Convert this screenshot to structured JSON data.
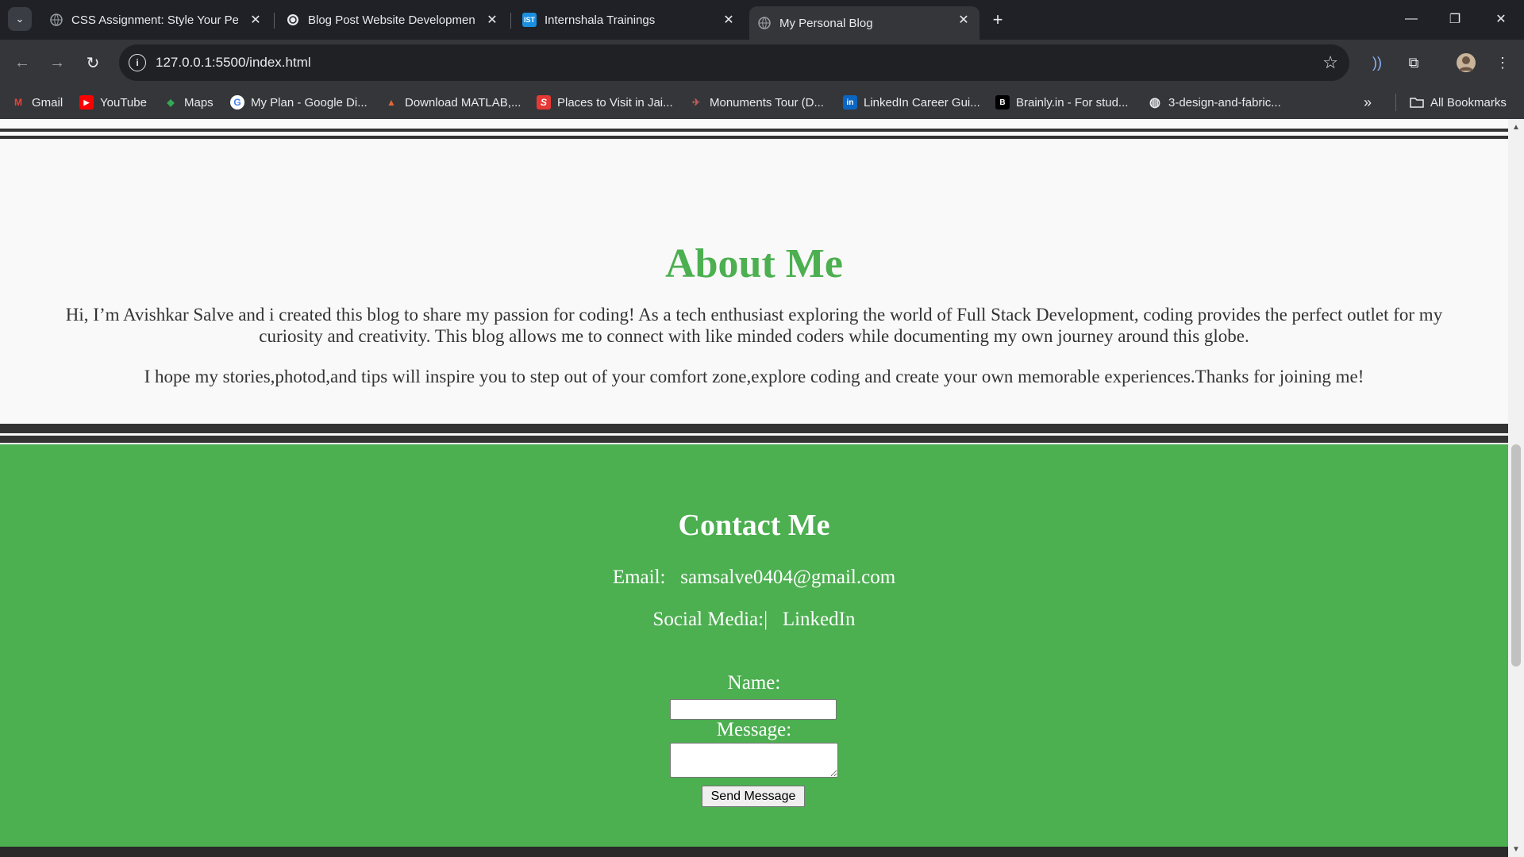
{
  "browser": {
    "tabs": [
      {
        "title": "CSS Assignment: Style Your Pers",
        "icon": "globe-icon"
      },
      {
        "title": "Blog Post Website Developmen",
        "icon": "chatgpt-icon"
      },
      {
        "title": "Internshala Trainings",
        "icon": "ist-icon",
        "icon_text": "IST"
      },
      {
        "title": "My Personal Blog",
        "icon": "globe-icon",
        "active": true
      }
    ],
    "url": "127.0.0.1:5500/index.html",
    "bookmarks": [
      {
        "label": "Gmail",
        "icon": "gmail-icon",
        "icon_text": "M"
      },
      {
        "label": "YouTube",
        "icon": "youtube-icon",
        "icon_text": "▶"
      },
      {
        "label": "Maps",
        "icon": "maps-icon",
        "icon_text": "◆"
      },
      {
        "label": "My Plan - Google Di...",
        "icon": "google-icon",
        "icon_text": "G"
      },
      {
        "label": "Download MATLAB,...",
        "icon": "matlab-icon",
        "icon_text": "▲"
      },
      {
        "label": "Places to Visit in Jai...",
        "icon": "s-icon",
        "icon_text": "S"
      },
      {
        "label": "Monuments Tour (D...",
        "icon": "monument-icon",
        "icon_text": "✈"
      },
      {
        "label": "LinkedIn Career Gui...",
        "icon": "linkedin-icon",
        "icon_text": "in"
      },
      {
        "label": "Brainly.in - For stud...",
        "icon": "brainly-icon",
        "icon_text": "B"
      },
      {
        "label": "3-design-and-fabric...",
        "icon": "globe-icon",
        "icon_text": "◍"
      }
    ],
    "all_bookmarks": "All Bookmarks"
  },
  "colors": {
    "accent_green": "#4caf50",
    "divider": "#333333",
    "page_bg": "#f9f9f9"
  },
  "about": {
    "heading": "About Me",
    "para1": "Hi, I’m Avishkar Salve and i created this blog to share my passion for coding! As a tech enthusiast exploring the world of Full Stack Development, coding provides the perfect outlet for my curiosity and creativity. This blog allows me to connect with like minded coders while documenting my own journey around this globe.",
    "para2": "I hope my stories,photod,and tips will inspire you to step out of your comfort zone,explore coding and create your own memorable experiences.Thanks for joining me!"
  },
  "contact": {
    "heading": "Contact Me",
    "email_label": "Email:",
    "email": "samsalve0404@gmail.com",
    "social_label": "Social Media:|",
    "social_link": "LinkedIn",
    "name_label": "Name:",
    "message_label": "Message:",
    "send_label": "Send Message"
  }
}
